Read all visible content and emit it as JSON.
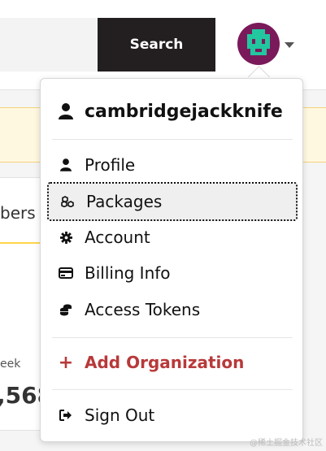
{
  "header": {
    "search_button_label": "Search"
  },
  "background": {
    "card_tab_label": "bers",
    "stat_label": "eek",
    "stat_value": ",568"
  },
  "user_menu": {
    "username": "cambridgejackknife",
    "items": [
      {
        "label": "Profile",
        "icon": "user-icon"
      },
      {
        "label": "Packages",
        "icon": "packages-icon"
      },
      {
        "label": "Account",
        "icon": "gear-icon"
      },
      {
        "label": "Billing Info",
        "icon": "credit-card-icon"
      },
      {
        "label": "Access Tokens",
        "icon": "coins-icon"
      },
      {
        "label": "Add Organization",
        "icon": "plus-icon"
      },
      {
        "label": "Sign Out",
        "icon": "sign-out-icon"
      }
    ]
  },
  "watermark": "@稀土掘金技术社区",
  "colors": {
    "search_button_bg": "#231f20",
    "add_org_red": "#b8393a",
    "avatar_bg": "#7a1a5a",
    "avatar_fg": "#22c7a0"
  }
}
